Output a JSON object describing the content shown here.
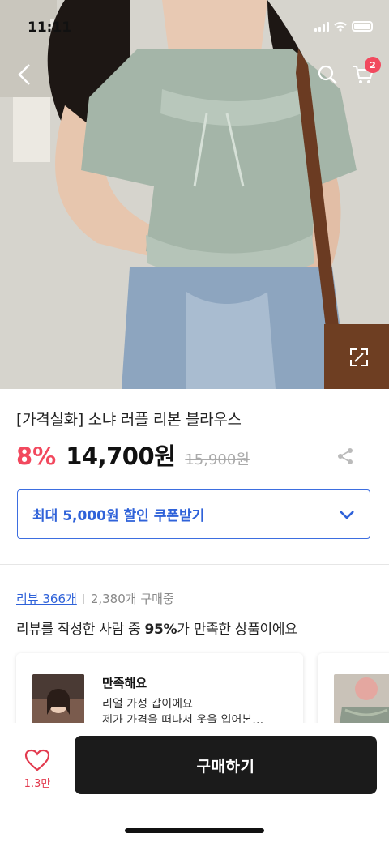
{
  "status_bar": {
    "time": "11:11"
  },
  "header": {
    "cart_count": "2",
    "icons": [
      "back-arrow-icon",
      "search-icon",
      "cart-icon"
    ]
  },
  "product": {
    "title": "[가격실화] 소냐 러플 리본 블라우스",
    "discount": "8%",
    "price": "14,700원",
    "original_price": "15,900원"
  },
  "coupon": {
    "label": "최대 5,000원 할인 쿠폰받기"
  },
  "reviews": {
    "link_text": "리뷰 366개",
    "buying_text": "2,380개 구매중",
    "satisfaction_pre": "리뷰를 작성한 사람 중 ",
    "satisfaction_pct": "95%",
    "satisfaction_post": "가 만족한 상품이에요",
    "cards": [
      {
        "title": "만족해요",
        "line1": "리얼 가성 갑이에요",
        "line2": "제가 가격을 떠나서 옷을 입어본…"
      }
    ]
  },
  "bottom": {
    "like_count": "1.3만",
    "buy_label": "구매하기"
  },
  "colors": {
    "accent_red": "#f2495e",
    "accent_blue": "#2f62d9",
    "buy_button": "#1b1b1b"
  }
}
